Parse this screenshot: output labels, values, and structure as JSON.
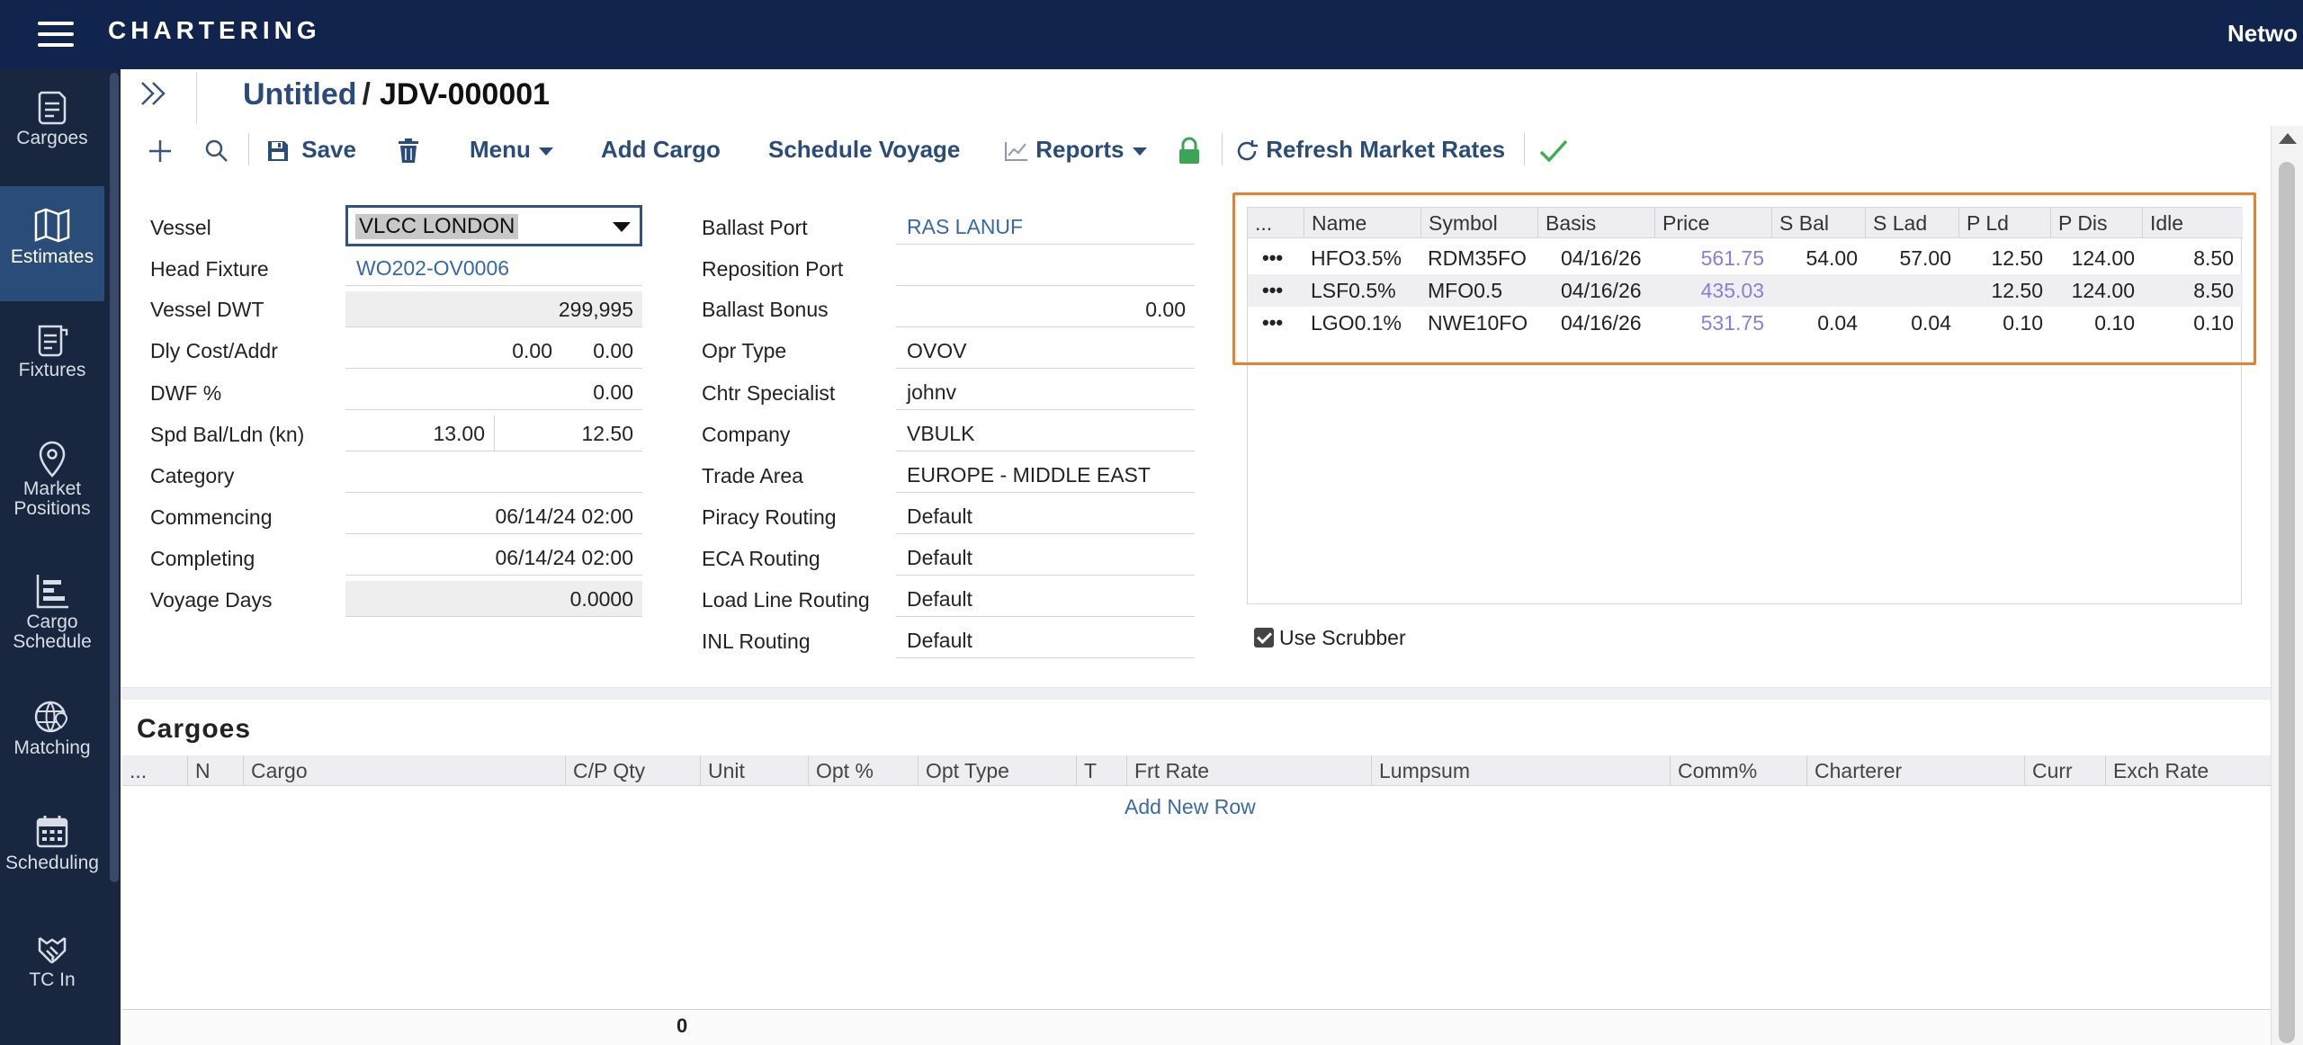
{
  "topbar": {
    "app_title": "CHARTERING",
    "network_label": "Netwo"
  },
  "nav": {
    "items": [
      {
        "label": "Cargoes",
        "icon": "cargo-doc-icon"
      },
      {
        "label": "Estimates",
        "icon": "map-icon"
      },
      {
        "label": "Fixtures",
        "icon": "fixture-doc-icon"
      },
      {
        "label_line1": "Market",
        "label_line2": "Positions",
        "icon": "location-pin-icon"
      },
      {
        "label_line1": "Cargo",
        "label_line2": "Schedule",
        "icon": "gantt-icon"
      },
      {
        "label": "Matching",
        "icon": "globe-pin-icon"
      },
      {
        "label": "Scheduling",
        "icon": "calendar-icon"
      },
      {
        "label": "TC In",
        "icon": "handshake-icon"
      }
    ],
    "active": "Estimates"
  },
  "breadcrumb": {
    "parent": "Untitled",
    "separator": "/",
    "current": "JDV-000001"
  },
  "toolbar": {
    "save": "Save",
    "menu": "Menu",
    "add_cargo": "Add Cargo",
    "schedule_voyage": "Schedule Voyage",
    "reports": "Reports",
    "refresh_market_rates": "Refresh Market Rates"
  },
  "form_left": {
    "vessel_label": "Vessel",
    "vessel_value": "VLCC LONDON",
    "head_fixture_label": "Head Fixture",
    "head_fixture_value": "WO202-OV0006",
    "vessel_dwt_label": "Vessel DWT",
    "vessel_dwt_value": "299,995",
    "dly_cost_label": "Dly Cost/Addr",
    "dly_cost_value": "0.00",
    "addr_value": "0.00",
    "dwf_label": "DWF %",
    "dwf_value": "0.00",
    "spd_label": "Spd Bal/Ldn (kn)",
    "spd_bal_value": "13.00",
    "spd_ldn_value": "12.50",
    "category_label": "Category",
    "category_value": "",
    "commencing_label": "Commencing",
    "commencing_value": "06/14/24 02:00",
    "completing_label": "Completing",
    "completing_value": "06/14/24 02:00",
    "voyage_days_label": "Voyage Days",
    "voyage_days_value": "0.0000"
  },
  "form_mid": {
    "ballast_port_label": "Ballast Port",
    "ballast_port_value": "RAS LANUF",
    "reposition_port_label": "Reposition Port",
    "reposition_port_value": "",
    "ballast_bonus_label": "Ballast Bonus",
    "ballast_bonus_value": "0.00",
    "opr_type_label": "Opr Type",
    "opr_type_value": "OVOV",
    "chtr_specialist_label": "Chtr Specialist",
    "chtr_specialist_value": "johnv",
    "company_label": "Company",
    "company_value": "VBULK",
    "trade_area_label": "Trade Area",
    "trade_area_value": "EUROPE - MIDDLE EAST",
    "piracy_label": "Piracy Routing",
    "piracy_value": "Default",
    "eca_label": "ECA Routing",
    "eca_value": "Default",
    "load_line_label": "Load Line Routing",
    "load_line_value": "Default",
    "inl_label": "INL Routing",
    "inl_value": "Default"
  },
  "bunkers": {
    "columns": [
      "...",
      "Name",
      "Symbol",
      "Basis",
      "Price",
      "S Bal",
      "S Lad",
      "P Ld",
      "P Dis",
      "Idle"
    ],
    "rows": [
      {
        "dots": "•••",
        "name": "HFO3.5%",
        "symbol": "RDM35FO",
        "basis": "04/16/26",
        "price": "561.75",
        "s_bal": "54.00",
        "s_lad": "57.00",
        "p_ld": "12.50",
        "p_dis": "124.00",
        "idle": "8.50"
      },
      {
        "dots": "•••",
        "name": "LSF0.5%",
        "symbol": "MFO0.5",
        "basis": "04/16/26",
        "price": "435.03",
        "s_bal": "",
        "s_lad": "",
        "p_ld": "12.50",
        "p_dis": "124.00",
        "idle": "8.50"
      },
      {
        "dots": "•••",
        "name": "LGO0.1%",
        "symbol": "NWE10FO",
        "basis": "04/16/26",
        "price": "531.75",
        "s_bal": "0.04",
        "s_lad": "0.04",
        "p_ld": "0.10",
        "p_dis": "0.10",
        "idle": "0.10"
      }
    ],
    "use_scrubber_label": "Use Scrubber",
    "use_scrubber_checked": true
  },
  "cargoes": {
    "title": "Cargoes",
    "columns": [
      "...",
      "N",
      "Cargo",
      "C/P Qty",
      "Unit",
      "Opt %",
      "Opt Type",
      "T",
      "Frt Rate",
      "Lumpsum",
      "Comm%",
      "Charterer",
      "Curr",
      "Exch Rate"
    ],
    "add_new_row": "Add New Row",
    "total_qty": "0"
  },
  "colors": {
    "topbar": "#10244e",
    "leftnav": "#18273f",
    "nav_active": "#2a4c78",
    "accent_link": "#2a4c78",
    "highlight_box": "#e8812f",
    "price_text": "#8a7ed6",
    "lock_green": "#3aa655",
    "check_green": "#3fae4f"
  }
}
